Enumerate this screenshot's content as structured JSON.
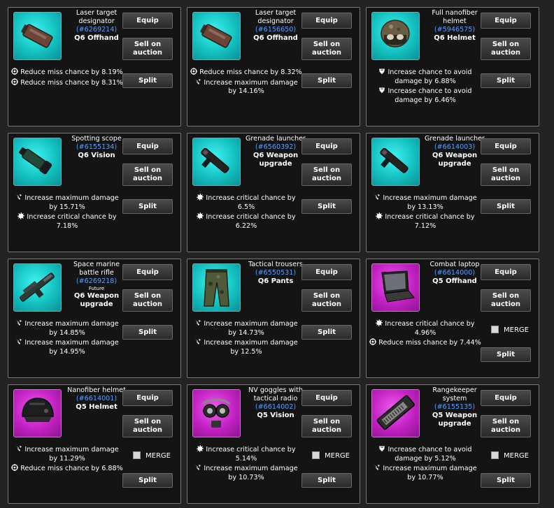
{
  "buttons": {
    "equip": "Equip",
    "sell": "Sell on auction",
    "split": "Split",
    "merge": "MERGE"
  },
  "items": [
    {
      "name": "Laser target designator",
      "id": "#6269214",
      "quality": "Q6 Offhand",
      "rarity": "teal",
      "icon": "laser-target-designator-icon",
      "merge": false,
      "stats": [
        {
          "icon": "crosshair-icon",
          "text": "Reduce miss chance by 8.19%"
        },
        {
          "icon": "crosshair-icon",
          "text": "Reduce miss chance by 8.31%"
        }
      ]
    },
    {
      "name": "Laser target designator",
      "id": "#6156650",
      "quality": "Q6 Offhand",
      "rarity": "teal",
      "icon": "laser-target-designator-icon",
      "merge": false,
      "stats": [
        {
          "icon": "crosshair-icon",
          "text": "Reduce miss chance by 8.32%"
        },
        {
          "icon": "damage-icon",
          "text": "Increase maximum damage by 14.16%"
        }
      ]
    },
    {
      "name": "Full nanofiber helmet",
      "id": "#5946575",
      "quality": "Q6 Helmet",
      "rarity": "teal",
      "icon": "full-helmet-icon",
      "merge": false,
      "stats": [
        {
          "icon": "shield-icon",
          "text": "Increase chance to avoid damage by 6.88%"
        },
        {
          "icon": "shield-icon",
          "text": "Increase chance to avoid damage by 6.46%"
        }
      ]
    },
    {
      "name": "Spotting scope",
      "id": "#6155134",
      "quality": "Q6 Vision",
      "rarity": "teal",
      "icon": "spotting-scope-icon",
      "merge": false,
      "stats": [
        {
          "icon": "damage-icon",
          "text": "Increase maximum damage by 15.71%"
        },
        {
          "icon": "critical-icon",
          "text": "Increase critical chance by 7.18%"
        }
      ]
    },
    {
      "name": "Grenade launcher",
      "id": "#6560392",
      "quality": "Q6 Weapon upgrade",
      "rarity": "teal",
      "icon": "grenade-launcher-icon",
      "merge": false,
      "stats": [
        {
          "icon": "critical-icon",
          "text": "Increase critical chance by 6.5%"
        },
        {
          "icon": "critical-icon",
          "text": "Increase critical chance by 6.22%"
        }
      ]
    },
    {
      "name": "Grenade launcher",
      "id": "#6614003",
      "quality": "Q6 Weapon upgrade",
      "rarity": "teal",
      "icon": "grenade-launcher-icon",
      "merge": false,
      "stats": [
        {
          "icon": "damage-icon",
          "text": "Increase maximum damage by 13.13%"
        },
        {
          "icon": "critical-icon",
          "text": "Increase critical chance by 7.12%"
        }
      ]
    },
    {
      "name": "Space marine battle rifle",
      "id": "#6269218",
      "tag": "Future",
      "quality": "Q6 Weapon upgrade",
      "rarity": "teal",
      "icon": "battle-rifle-icon",
      "merge": false,
      "stats": [
        {
          "icon": "damage-icon",
          "text": "Increase maximum damage by 14.85%"
        },
        {
          "icon": "damage-icon",
          "text": "Increase maximum damage by 14.95%"
        }
      ]
    },
    {
      "name": "Tactical trousers",
      "id": "#6550531",
      "quality": "Q6 Pants",
      "rarity": "teal",
      "icon": "tactical-trousers-icon",
      "merge": false,
      "stats": [
        {
          "icon": "damage-icon",
          "text": "Increase maximum damage by 14.73%"
        },
        {
          "icon": "damage-icon",
          "text": "Increase maximum damage by 12.5%"
        }
      ]
    },
    {
      "name": "Combat laptop",
      "id": "#6614000",
      "quality": "Q5 Offhand",
      "rarity": "magenta",
      "icon": "combat-laptop-icon",
      "merge": true,
      "stats": [
        {
          "icon": "critical-icon",
          "text": "Increase critical chance by 4.96%"
        },
        {
          "icon": "crosshair-icon",
          "text": "Reduce miss chance by 7.44%"
        }
      ]
    },
    {
      "name": "Nanofiber helmet",
      "id": "#6614001",
      "quality": "Q5 Helmet",
      "rarity": "magenta",
      "icon": "nanofiber-helmet-icon",
      "merge": true,
      "stats": [
        {
          "icon": "damage-icon",
          "text": "Increase maximum damage by 11.29%"
        },
        {
          "icon": "crosshair-icon",
          "text": "Reduce miss chance by 6.88%"
        }
      ]
    },
    {
      "name": "NV goggles with tactical radio",
      "id": "#6614002",
      "quality": "Q5 Vision",
      "rarity": "magenta",
      "icon": "nv-goggles-icon",
      "merge": true,
      "stats": [
        {
          "icon": "critical-icon",
          "text": "Increase critical chance by 5.14%"
        },
        {
          "icon": "damage-icon",
          "text": "Increase maximum damage by 10.73%"
        }
      ]
    },
    {
      "name": "Rangekeeper system",
      "id": "#6155135",
      "quality": "Q5 Weapon upgrade",
      "rarity": "magenta",
      "icon": "rangekeeper-system-icon",
      "merge": true,
      "stats": [
        {
          "icon": "shield-icon",
          "text": "Increase chance to avoid damage by 5.12%"
        },
        {
          "icon": "damage-icon",
          "text": "Increase maximum damage by 10.77%"
        }
      ]
    }
  ]
}
